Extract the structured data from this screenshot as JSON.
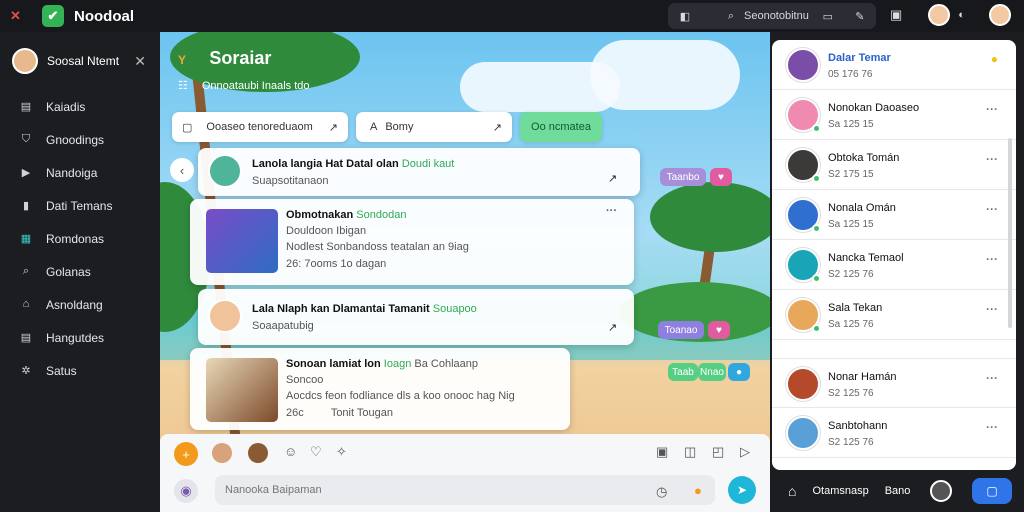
{
  "topbar": {
    "app_title": "Noodoal",
    "search_label": "Seonotobitnu"
  },
  "sidebar": {
    "profile_name": "Soosal Ntemt",
    "items": [
      {
        "label": "Kaiadis",
        "icon": "chart-icon"
      },
      {
        "label": "Gnoodings",
        "icon": "shield-icon"
      },
      {
        "label": "Nandoiga",
        "icon": "play-icon"
      },
      {
        "label": "Dati Temans",
        "icon": "book-icon"
      },
      {
        "label": "Romdonas",
        "icon": "grid-icon"
      },
      {
        "label": "Golanas",
        "icon": "search-icon"
      },
      {
        "label": "Asnoldang",
        "icon": "shop-icon"
      },
      {
        "label": "Hangutdes",
        "icon": "notes-icon"
      },
      {
        "label": "Satus",
        "icon": "gear-icon"
      }
    ]
  },
  "channel": {
    "title": "Soraiar",
    "subtitle": "Onnoataubi Inaals tdo"
  },
  "filters": {
    "filter1": "Ooaseo tenoreduaom",
    "filter2": "Bomy",
    "action": "Oo ncmatea"
  },
  "posts": [
    {
      "title": "Lanola langia Hat Datal olan",
      "highlight": "Doudi kaut",
      "sub": "Suapsotitanaon"
    },
    {
      "title": "Obmotnakan",
      "highlight": "Sondodan",
      "line2": "Douldoon Ibigan",
      "line3": "Nodlest Sonbandoss teatalan an 9iag",
      "stats": "26: 7ooms 1o dagan"
    },
    {
      "title": "Lala Nlaph kan Dlamantai Tamanit",
      "highlight": "Souapoo",
      "sub": "Soaapatubig"
    },
    {
      "title": "Sonoan lamiat lon",
      "highlight": "Ioagn",
      "extra": "Ba Cohlaanp",
      "line2": "Soncoo",
      "line3": "Aocdcs feon fodliance dls a koo onooc hag Nig",
      "stats": "26c",
      "stats2": "Tonit Tougan"
    }
  ],
  "tags": [
    {
      "label": "Taanbo",
      "color": "#a78ed8"
    },
    {
      "label": "Toanao",
      "color": "#8f7fe0"
    },
    {
      "label": "Taab",
      "color": "#56cf84"
    },
    {
      "label": "Nnao",
      "color": "#56cf84"
    }
  ],
  "composer": {
    "placeholder": "Nanooka Baipaman"
  },
  "friends": [
    {
      "name": "Dalar Temar",
      "status": "05 176 76",
      "online": false,
      "color": "#7a4ea8"
    },
    {
      "name": "Nonokan Daoaseo",
      "status": "Sa 125 15",
      "online": true,
      "color": "#f08ab0"
    },
    {
      "name": "Obtoka Tomán",
      "status": "S2 175 15",
      "online": true,
      "color": "#3b3a38"
    },
    {
      "name": "Nonala Omán",
      "status": "Sa 125 15",
      "online": true,
      "color": "#2f6fd0"
    },
    {
      "name": "Nancka Temaol",
      "status": "S2 125 76",
      "online": true,
      "color": "#1aa4b8"
    },
    {
      "name": "Sala Tekan",
      "status": "Sa 125 76",
      "online": true,
      "color": "#e8a85c"
    },
    {
      "name": "Nonar Hamán",
      "status": "S2 125 76",
      "online": false,
      "color": "#b44a2a"
    },
    {
      "name": "Sanbtohann",
      "status": "S2 125 76",
      "online": false,
      "color": "#5aa0d8"
    }
  ],
  "footer": {
    "label": "Otamsnasp",
    "label2": "Bano"
  }
}
